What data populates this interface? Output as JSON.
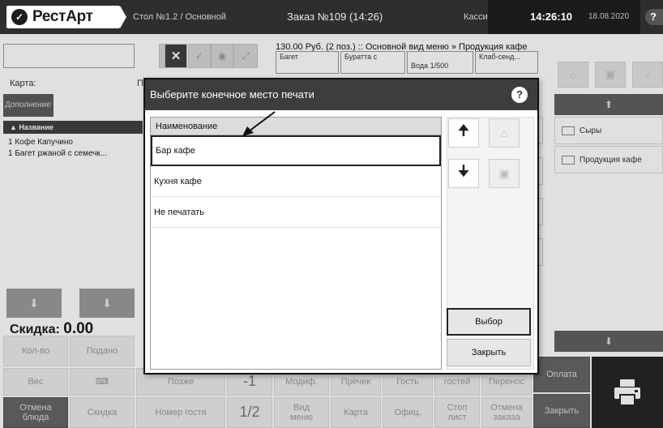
{
  "app": {
    "name": "РестАрт",
    "logo_icon": "logo-icon"
  },
  "header": {
    "table": "Стол №1.2 / Основной",
    "order": "Заказ №109 (14:26)",
    "role": "Кассир",
    "time": "14:26:10",
    "date": "18.08.2020",
    "help": "?"
  },
  "left": {
    "card_label": "Карта:",
    "card_label_r": "П",
    "addon_btn": "Дополнение",
    "order_col_name": "Название",
    "order_items": [
      {
        "qty": "1",
        "name": "Кофе Капучино"
      },
      {
        "qty": "1",
        "name": "Багет ржаной с семечк..."
      }
    ],
    "discount_label": "Скидка:",
    "discount_value": "0.00"
  },
  "menu": {
    "path": "130.00 Руб. (2 поз.)  ::  Основной вид меню » Продукция кафе",
    "tiles": [
      "Багет",
      "Буратта с",
      "Вода 1/500",
      "Клаб-сенд..."
    ]
  },
  "right": {
    "folders": [
      "Сыры",
      "Продукция кафе"
    ]
  },
  "bottom": {
    "qty": "Кол-во",
    "served": "Подано",
    "weight": "Вес",
    "later": "Позже",
    "minus_one": "-1",
    "half": "1/2",
    "cancel_dish": "Отмена\nблюда",
    "discount": "Скидка",
    "guest_number": "Номер гостя",
    "modifier": "Модиф.",
    "precheck": "Пречек",
    "guests_short": "Гость",
    "guests": "гостей",
    "transfer": "Перенос",
    "payment": "Оплата",
    "menu_view": "Вид\nменю",
    "card": "Карта",
    "waiter": "Офиц.",
    "stop_list": "Стоп\nлист",
    "cancel_order": "Отмена\nзаказа",
    "close": "Закрыть"
  },
  "dialog": {
    "title": "Выберите конечное место печати",
    "help": "?",
    "column_header": "Наименование",
    "items": [
      "Бар кафе",
      "Кухня кафе",
      "Не печатать"
    ],
    "select_btn": "Выбор",
    "close_btn": "Закрыть"
  }
}
